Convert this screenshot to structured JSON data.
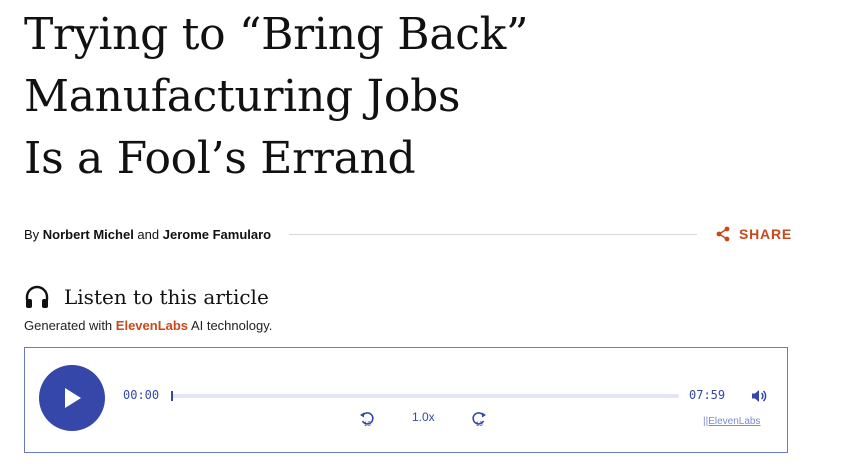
{
  "article": {
    "title_lines": [
      "Trying to “Bring Back”",
      "Manufacturing Jobs",
      "Is a Fool’s Errand"
    ],
    "byline_prefix": "By ",
    "author1": "Norbert Michel",
    "byline_and": " and ",
    "author2": "Jerome Famularo",
    "share_label": "SHARE"
  },
  "listen": {
    "title": "Listen to this article",
    "generated_prefix": "Generated with ",
    "brand": "ElevenLabs",
    "generated_suffix": " AI technology."
  },
  "player": {
    "current_time": "00:00",
    "total_time": "07:59",
    "speed": "1.0x",
    "skip_seconds": "15",
    "credit": "||ElevenLabs",
    "progress": 0
  },
  "colors": {
    "accent": "#c8491c",
    "player_blue": "#3547a8"
  },
  "icons": [
    "share-icon",
    "headphones-icon",
    "play-icon",
    "rewind-15-icon",
    "forward-15-icon",
    "volume-icon"
  ]
}
